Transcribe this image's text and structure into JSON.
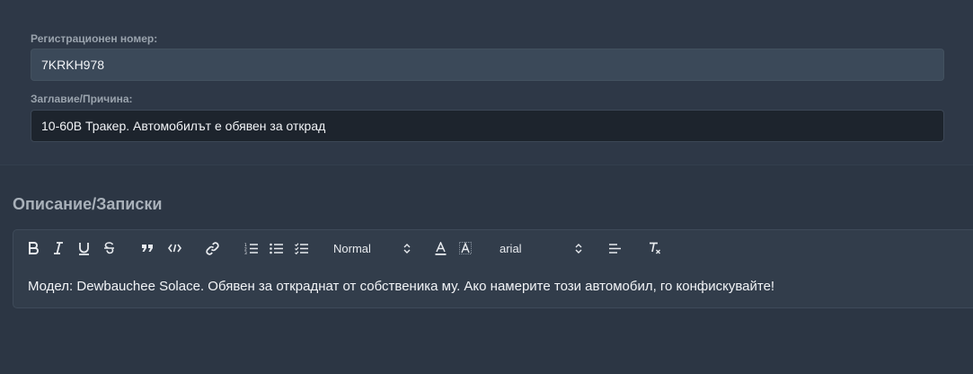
{
  "vehicle": {
    "plate_label": "Регистрационен номер:",
    "plate_value": "7KRKH978",
    "title_label": "Заглавие/Причина:",
    "title_value": "10-60B Тракер. Автомобилът е обявен за открад"
  },
  "description": {
    "heading": "Описание/Записки",
    "content": "Модел: Dewbauchee Solace. Обявен за откраднат от собственика му. Ако намерите този автомобил, го конфискувайте!"
  },
  "toolbar": {
    "header_select": "Normal",
    "font_select": "arial",
    "icons": [
      "bold-icon",
      "italic-icon",
      "underline-icon",
      "strike-icon",
      "blockquote-icon",
      "code-icon",
      "link-icon",
      "ordered-list-icon",
      "bullet-list-icon",
      "check-list-icon",
      "text-color-icon",
      "background-color-icon",
      "align-icon",
      "clear-format-icon"
    ]
  },
  "colors": {
    "background": "#2c3644",
    "input_plate": "#3b4959",
    "input_title": "#1d242d",
    "editor": "#323d4b"
  }
}
